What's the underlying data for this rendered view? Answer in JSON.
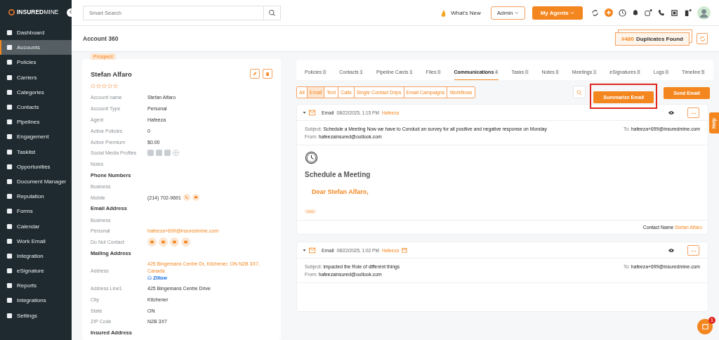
{
  "sidebar": {
    "logo": "**INSURED**MINE",
    "items": [
      {
        "label": "Dashboard",
        "selected": false
      },
      {
        "label": "Accounts",
        "selected": true
      },
      {
        "label": "Policies",
        "selected": false
      },
      {
        "label": "Carriers",
        "selected": false
      },
      {
        "label": "Categories",
        "selected": false
      },
      {
        "label": "Contacts",
        "selected": false
      },
      {
        "label": "Pipelines",
        "selected": false
      },
      {
        "label": "Engagement",
        "selected": false
      },
      {
        "label": "Tasklist",
        "selected": false
      },
      {
        "label": "Opportunities",
        "selected": false
      },
      {
        "label": "Document Manager",
        "selected": false
      },
      {
        "label": "Reputation",
        "selected": false
      },
      {
        "label": "Forms",
        "selected": false
      },
      {
        "label": "Calendar",
        "selected": false
      },
      {
        "label": "Work Email",
        "selected": false
      },
      {
        "label": "Integration",
        "selected": false
      },
      {
        "label": "eSignature",
        "selected": false
      },
      {
        "label": "Reports",
        "selected": false
      },
      {
        "label": "Integrations",
        "selected": false
      },
      {
        "label": "Settings",
        "selected": false
      }
    ]
  },
  "topbar": {
    "search": {
      "placeholder": "Smart Search"
    },
    "whats_new": "What's New",
    "role": "Admin",
    "agents_button": "My Agents"
  },
  "header": {
    "title": "Account 360",
    "duplicates": {
      "count": "#480",
      "label": "Duplicates Found"
    }
  },
  "account": {
    "badge": "Prospect",
    "name": "Stefan Alfaro",
    "stars": 0,
    "fields": [
      {
        "kind": "plain",
        "label": "Account name",
        "value": "Stefan Alfaro"
      },
      {
        "kind": "plain",
        "label": "Account Type",
        "value": "Personal"
      },
      {
        "kind": "plain",
        "label": "Agent",
        "value": "Hafeeza"
      },
      {
        "kind": "plain",
        "label": "Active Policies",
        "value": "0"
      },
      {
        "kind": "plain",
        "label": "Active Premium",
        "value": "$0.00"
      },
      {
        "kind": "social",
        "label": "Social Media Profiles"
      },
      {
        "kind": "plain",
        "label": "Notes"
      },
      {
        "kind": "heading",
        "label": "Phone Numbers"
      },
      {
        "kind": "plain",
        "label": "Business"
      },
      {
        "kind": "phone",
        "label": "Mobile",
        "value": "(214) 702-9691"
      },
      {
        "kind": "heading",
        "label": "Email Address"
      },
      {
        "kind": "plain",
        "label": "Business"
      },
      {
        "kind": "link",
        "label": "Personal",
        "value": "hafeeza+699@insuredmine.com"
      },
      {
        "kind": "contact",
        "label": "Do Not Contact"
      },
      {
        "kind": "heading",
        "label": "Mailing Address"
      },
      {
        "kind": "address",
        "label": "Address",
        "value": "425 Bingemans Centre Dr, Kitchener, ON N2B 3X7, Canada",
        "extra": "Zillow"
      },
      {
        "kind": "plain",
        "label": "Address Line1",
        "value": "425 Bingemans Centre Drive"
      },
      {
        "kind": "plain",
        "label": "City",
        "value": "Kitchener"
      },
      {
        "kind": "plain",
        "label": "State",
        "value": "ON"
      },
      {
        "kind": "plain",
        "label": "ZIP Code",
        "value": "N2B 3X7"
      },
      {
        "kind": "heading",
        "label": "Insured Address"
      }
    ]
  },
  "tabs": [
    {
      "label": "Policies",
      "count": "0",
      "selected": false
    },
    {
      "label": "Contacts",
      "count": "1",
      "selected": false
    },
    {
      "label": "Pipeline Cards",
      "count": "1",
      "selected": false
    },
    {
      "label": "Files",
      "count": "0",
      "selected": false
    },
    {
      "label": "Communications",
      "count": "4",
      "selected": true
    },
    {
      "label": "Tasks",
      "count": "0",
      "selected": false
    },
    {
      "label": "Notes",
      "count": "0",
      "selected": false
    },
    {
      "label": "Meetings",
      "count": "1",
      "selected": false
    },
    {
      "label": "eSignatures",
      "count": "0",
      "selected": false
    },
    {
      "label": "Logs",
      "count": "0",
      "selected": false
    },
    {
      "label": "Timeline",
      "count": "5",
      "selected": false
    }
  ],
  "filters": [
    {
      "label": "All",
      "selected": false
    },
    {
      "label": "Email",
      "selected": true
    },
    {
      "label": "Text",
      "selected": false
    },
    {
      "label": "Calls",
      "selected": false
    },
    {
      "label": "Single Contact Drips",
      "selected": false
    },
    {
      "label": "Email Campaigns",
      "selected": false
    },
    {
      "label": "Workflows",
      "selected": false
    }
  ],
  "actions": [
    {
      "label": "Summarize Email",
      "highlighted": true
    },
    {
      "label": "Send Email",
      "highlighted": false
    }
  ],
  "emails": [
    {
      "type": "Email",
      "date": "08/22/2025, 1:15 PM",
      "agent": "Hafeeza",
      "scheduled": false,
      "subject_label": "Subject:",
      "subject": "Schedule a Meeting Now we have to Conduct an survey for all positive and negative response on Monday",
      "from_label": "From:",
      "from": "hafeezainsured@outlook.com",
      "to_label": "To:",
      "to": "hafeeza+699@insuredmine.com",
      "body_title": "Schedule a Meeting",
      "greeting": "Dear Stefan Alfaro,",
      "contact_label": "Contact Name",
      "contact": "Stefan Alfaro"
    },
    {
      "type": "Email",
      "date": "08/22/2025, 1:02 PM",
      "agent": "Hafeeza",
      "scheduled": true,
      "subject_label": "Subject:",
      "subject": "impacted the Role of different things",
      "from_label": "From:",
      "from": "hafeezainsured@outlook.com",
      "to_label": "To:",
      "to": "hafeeza+699@insuredmine.com"
    }
  ],
  "help": "Help",
  "chat_badge": "1"
}
